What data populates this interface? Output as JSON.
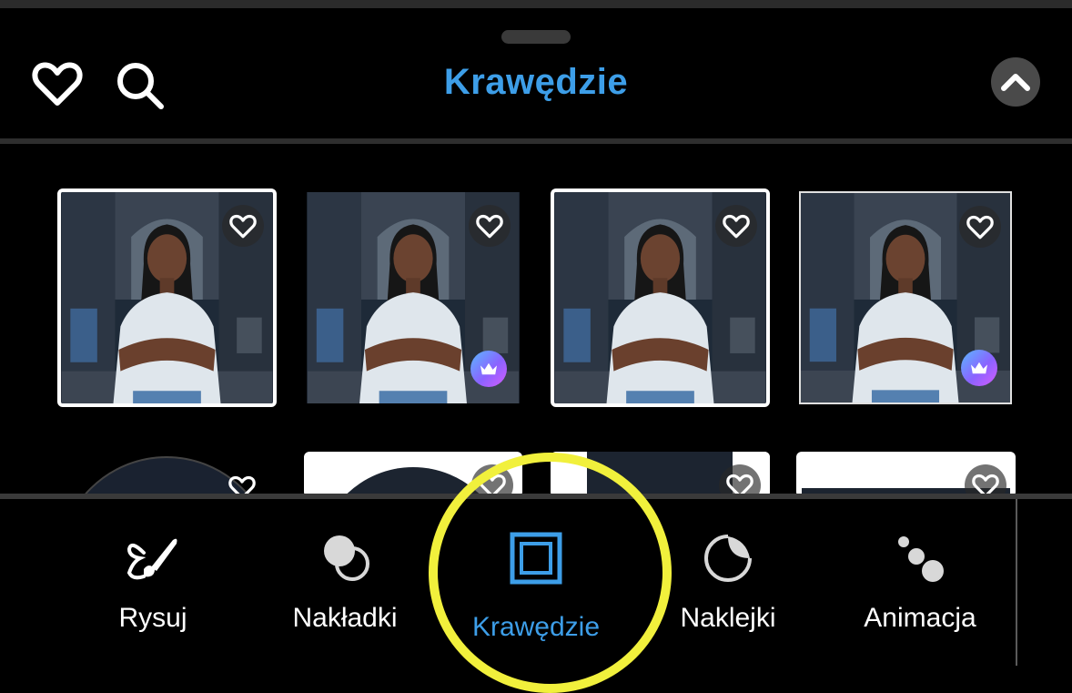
{
  "header": {
    "title": "Krawędzie",
    "favorites_icon": "heart-outline-icon",
    "search_icon": "search-icon",
    "collapse_icon": "chevron-up-icon"
  },
  "grid": {
    "thumbnails": [
      {
        "style": "thick-white-border",
        "favorite": true,
        "premium": false
      },
      {
        "style": "no-border",
        "favorite": true,
        "premium": true
      },
      {
        "style": "thick-white-border",
        "favorite": true,
        "premium": false
      },
      {
        "style": "thin-white-border",
        "favorite": true,
        "premium": true
      },
      {
        "style": "circle",
        "favorite": true,
        "premium": false
      },
      {
        "style": "white-frame-circle",
        "favorite": true,
        "premium": false
      },
      {
        "style": "split-white",
        "favorite": true,
        "premium": false
      },
      {
        "style": "white-frame",
        "favorite": true,
        "premium": false
      }
    ]
  },
  "toolbar": {
    "items": [
      {
        "label": "Rysuj",
        "icon": "brush-icon",
        "active": false
      },
      {
        "label": "Nakładki",
        "icon": "overlays-icon",
        "active": false
      },
      {
        "label": "Krawędzie",
        "icon": "borders-icon",
        "active": true
      },
      {
        "label": "Naklejki",
        "icon": "sticker-icon",
        "active": false
      },
      {
        "label": "Animacja",
        "icon": "animation-icon",
        "active": false
      }
    ]
  },
  "colors": {
    "accent": "#3d9ee8",
    "highlight": "#f1f03c",
    "background": "#000000"
  }
}
